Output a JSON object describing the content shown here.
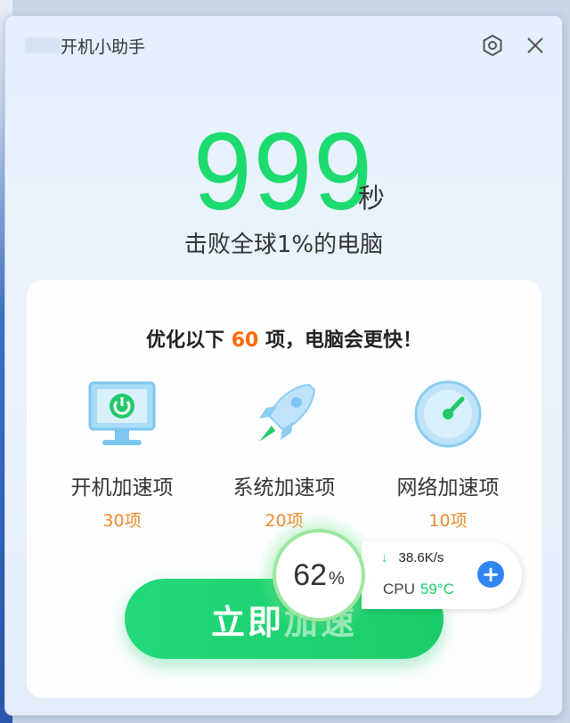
{
  "window": {
    "title": "开机小助手"
  },
  "score": {
    "value": "999",
    "unit": "秒",
    "beat_text": "击败全球1%的电脑"
  },
  "card": {
    "headline_pre": "优化以下 ",
    "headline_count": "60",
    "headline_post": " 项，电脑会更快！",
    "features": [
      {
        "icon": "monitor-power-icon",
        "name": "开机加速项",
        "count": "30项"
      },
      {
        "icon": "rocket-icon",
        "name": "系统加速项",
        "count": "20项"
      },
      {
        "icon": "speedometer-icon",
        "name": "网络加速项",
        "count": "10项"
      }
    ],
    "cta": {
      "label_main": "立即",
      "label_faded": "加速"
    }
  },
  "floating": {
    "percent": "62",
    "percent_sign": "%",
    "net_speed": "38.6K/s",
    "cpu_label": "CPU",
    "cpu_temp": "59°C",
    "plus": "+"
  },
  "colors": {
    "accent_green": "#1ddb6e",
    "count_orange": "#e88a2c",
    "highlight_orange": "#ff6a00",
    "plus_blue": "#2f86f0"
  }
}
